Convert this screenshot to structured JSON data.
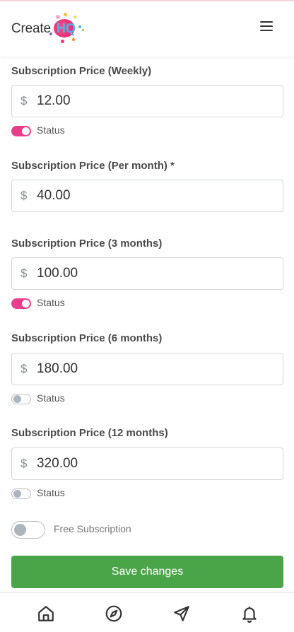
{
  "header": {
    "logo_text": "Create",
    "logo_badge": "HQ",
    "menu_icon": "hamburger-menu-icon"
  },
  "fields": [
    {
      "label": "Subscription Price (Weekly)",
      "currency": "$",
      "value": "12.00",
      "status_label": "Status",
      "status_on": true
    },
    {
      "label": "Subscription Price (Per month) *",
      "currency": "$",
      "value": "40.00"
    },
    {
      "label": "Subscription Price (3 months)",
      "currency": "$",
      "value": "100.00",
      "status_label": "Status",
      "status_on": true
    },
    {
      "label": "Subscription Price (6 months)",
      "currency": "$",
      "value": "180.00",
      "status_label": "Status",
      "status_on": false
    },
    {
      "label": "Subscription Price (12 months)",
      "currency": "$",
      "value": "320.00",
      "status_label": "Status",
      "status_on": false
    }
  ],
  "free_subscription": {
    "label": "Free Subscription",
    "on": false
  },
  "save_button": {
    "label": "Save changes"
  },
  "bottom_nav": [
    {
      "icon": "home-icon"
    },
    {
      "icon": "compass-icon"
    },
    {
      "icon": "send-icon"
    },
    {
      "icon": "bell-icon"
    }
  ],
  "colors": {
    "toggle_on": "#e83e8c",
    "save_button": "#4aa548",
    "logo_pink": "#e9327a",
    "logo_blue": "#4ab6e8"
  }
}
